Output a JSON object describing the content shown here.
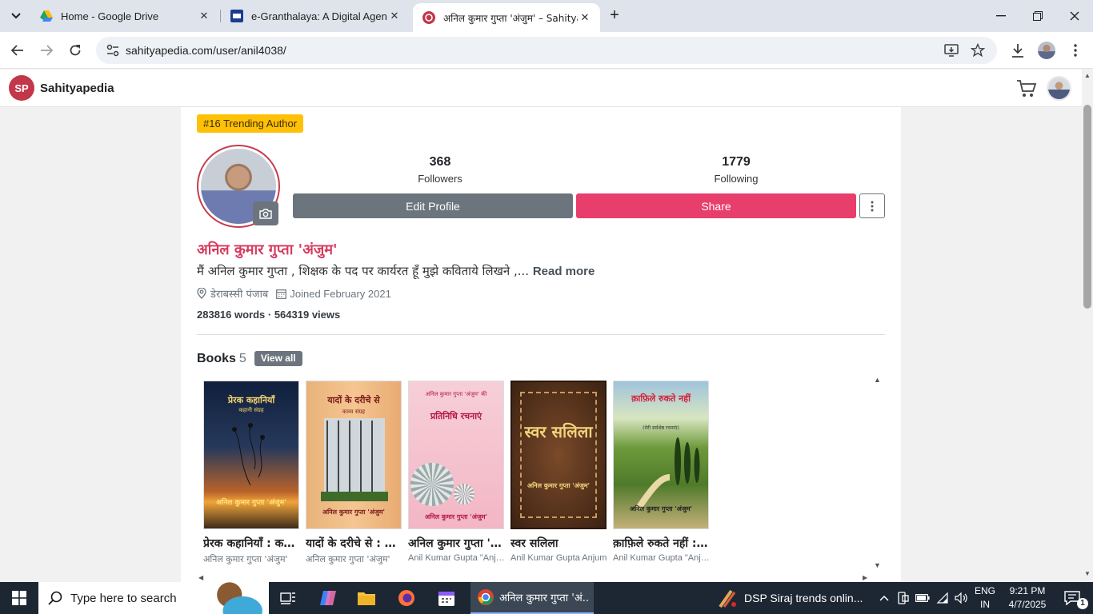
{
  "browser": {
    "tabs": [
      {
        "title": "Home - Google Drive",
        "close": "✕"
      },
      {
        "title": "e-Granthalaya: A Digital Agenda",
        "close": "✕"
      },
      {
        "title": "अनिल कुमार गुप्ता 'अंजुम' – Sahitya",
        "close": "✕"
      }
    ],
    "new_tab": "+",
    "url": "sahityapedia.com/user/anil4038/"
  },
  "site": {
    "logo_text": "SP",
    "name": "Sahityapedia"
  },
  "profile": {
    "badge": "#16 Trending Author",
    "followers_count": "368",
    "followers_label": "Followers",
    "following_count": "1779",
    "following_label": "Following",
    "edit_label": "Edit Profile",
    "share_label": "Share",
    "name": "अनिल कुमार गुप्ता 'अंजुम'",
    "bio": "मैं अनिल कुमार गुप्ता , शिक्षक के पद पर कार्यरत हूँ मुझे कविताये लिखने ,...",
    "read_more": "Read more",
    "location": "डेराबस्सी पंजाब",
    "joined": "Joined February 2021",
    "stats": "283816 words · 564319 views"
  },
  "books": {
    "heading": "Books",
    "count": "5",
    "view_all": "View all",
    "items": [
      {
        "title": "प्रेरक कहानियाँ : कहानी संग्रह",
        "author": "अनिल कुमार गुप्ता 'अंजुम'",
        "cover_title": "प्रेरक कहानियाँ",
        "cover_sub": "कहानी संग्रह",
        "cover_author": "अनिल कुमार गुप्ता 'अंजुम'"
      },
      {
        "title": "यादों के दरीचे से : काव्य संग्रह",
        "author": "अनिल कुमार गुप्ता 'अंजुम'",
        "cover_title": "यादों के दरीचे से",
        "cover_sub": "काव्य संग्रह",
        "cover_author": "अनिल कुमार गुप्ता 'अंजुम'"
      },
      {
        "title": "अनिल कुमार गुप्ता 'अंजुम' की प्रतिनिधि रचनाएं",
        "author": "Anil Kumar Gupta \"Anjum\"",
        "cover_title": "प्रतिनिधि रचनाएं",
        "cover_sub": "अनिल कुमार गुप्ता 'अंजुम' की",
        "cover_author": "अनिल कुमार गुप्ता 'अंजुम'"
      },
      {
        "title": "स्वर सलिला",
        "author": "Anil Kumar Gupta Anjum",
        "cover_title": "स्वर सलिला",
        "cover_sub": "",
        "cover_author": "अनिल कुमार गुप्ता 'अंजुम'"
      },
      {
        "title": "क़ाफ़िले रुकते नहीं : श्रेष्ठ रचनाएं",
        "author": "Anil Kumar Gupta \"Anjum\"",
        "cover_title": "क़ाफ़िले रुकते नहीं",
        "cover_sub": "(मेरी सर्वश्रेष्ठ रचनाएं)",
        "cover_author": "अनिल कुमार गुप्ता 'अंजुम'"
      }
    ]
  },
  "taskbar": {
    "search_placeholder": "Type here to search",
    "chrome_label": "अनिल कुमार गुप्ता 'अं...",
    "news": "DSP Siraj trends onlin...",
    "lang_line1": "ENG",
    "lang_line2": "IN",
    "time": "9:21 PM",
    "date": "4/7/2025",
    "notif_count": "1"
  },
  "colors": {
    "accent_pink": "#e83e6c",
    "name_pink": "#d63a5e",
    "badge_yellow": "#ffc107",
    "secondary_gray": "#6c757d"
  }
}
